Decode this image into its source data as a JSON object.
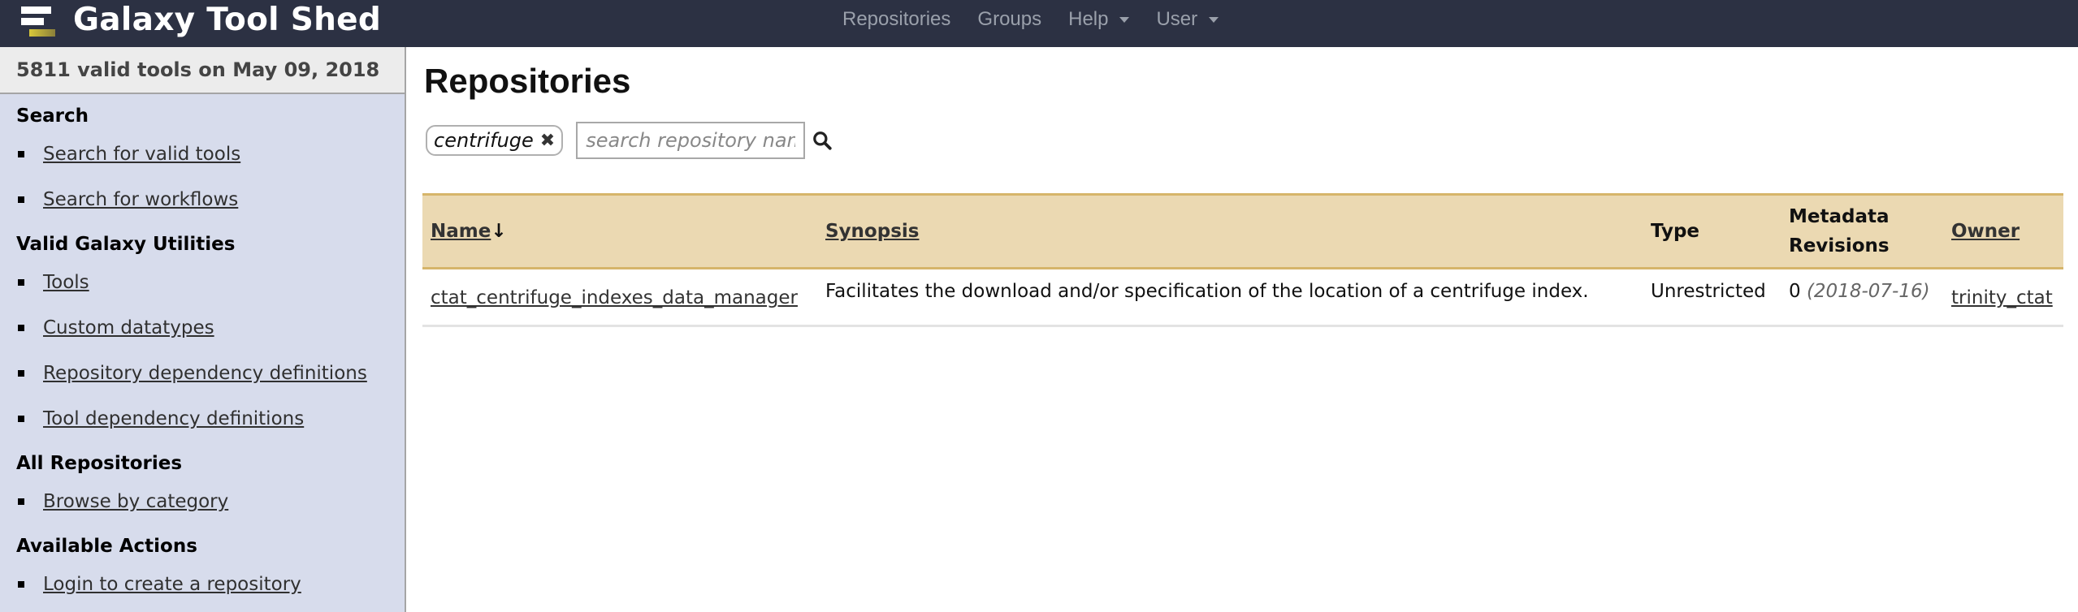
{
  "masthead": {
    "title": "Galaxy Tool Shed",
    "nav": [
      {
        "label": "Repositories",
        "dropdown": false
      },
      {
        "label": "Groups",
        "dropdown": false
      },
      {
        "label": "Help",
        "dropdown": true
      },
      {
        "label": "User",
        "dropdown": true
      }
    ]
  },
  "sidebar": {
    "header": "5811 valid tools on May 09, 2018",
    "sections": [
      {
        "title": "Search",
        "items": [
          "Search for valid tools",
          "Search for workflows"
        ]
      },
      {
        "title": "Valid Galaxy Utilities",
        "items": [
          "Tools",
          "Custom datatypes",
          "Repository dependency definitions",
          "Tool dependency definitions"
        ]
      },
      {
        "title": "All Repositories",
        "items": [
          "Browse by category"
        ]
      },
      {
        "title": "Available Actions",
        "items": [
          "Login to create a repository"
        ]
      }
    ]
  },
  "main": {
    "title": "Repositories",
    "filter_chip": "centrifuge",
    "search_placeholder": "search repository name, description",
    "table": {
      "columns": [
        {
          "label": "Name",
          "sortable": true,
          "sort_indicator": "↓"
        },
        {
          "label": "Synopsis",
          "sortable": true
        },
        {
          "label": "Type",
          "sortable": false
        },
        {
          "label": "Metadata Revisions",
          "sortable": false
        },
        {
          "label": "Owner",
          "sortable": true
        }
      ],
      "rows": [
        {
          "name": "ctat_centrifuge_indexes_data_manager",
          "synopsis": "Facilitates the download and/or specification of the location of a centrifuge index.",
          "type": "Unrestricted",
          "revision": "0",
          "revision_date": "(2018-07-16)",
          "owner": "trinity_ctat"
        }
      ]
    }
  }
}
